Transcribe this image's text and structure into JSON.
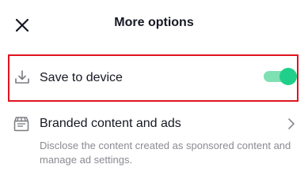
{
  "header": {
    "title": "More options",
    "close_icon": "close-icon"
  },
  "settings": {
    "save_to_device": {
      "label": "Save to device",
      "icon": "download-icon",
      "enabled": true,
      "toggle_color": "#20d08a"
    },
    "branded_content": {
      "label": "Branded content and ads",
      "icon": "brand-icon",
      "description": "Disclose the content created as sponsored content and manage ad settings."
    }
  },
  "colors": {
    "highlight_border": "#e0141e",
    "toggle_on": "#20d08a",
    "text_primary": "#161823",
    "text_secondary": "#8a8b91"
  }
}
